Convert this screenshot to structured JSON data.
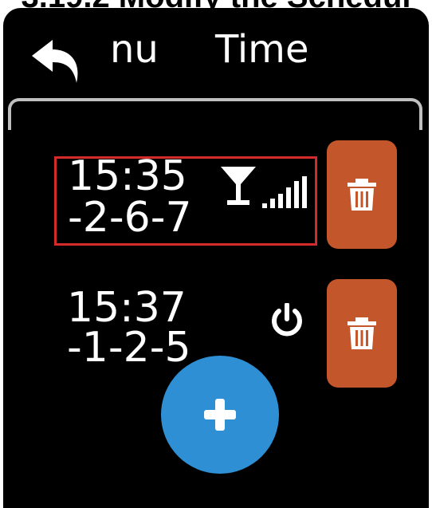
{
  "caption": "3.19.2 Modify the Schedul",
  "header": {
    "back_icon": "back-arrow-icon",
    "menu_partial": "nu",
    "title": "Time"
  },
  "schedules": [
    {
      "time": "15:35",
      "days": "-2-6-7",
      "icons": [
        "cocktail-glass-icon",
        "signal-bars-icon"
      ],
      "selected": true
    },
    {
      "time": "15:37",
      "days": "-1-2-5",
      "icons": [
        "power-icon"
      ],
      "selected": false
    }
  ],
  "colors": {
    "background": "#000000",
    "delete_button": "#c4562b",
    "fab": "#2f8fd4",
    "selection_border": "#d42a2a"
  },
  "actions": {
    "delete_icon": "trash-icon",
    "add_icon": "plus-icon"
  }
}
